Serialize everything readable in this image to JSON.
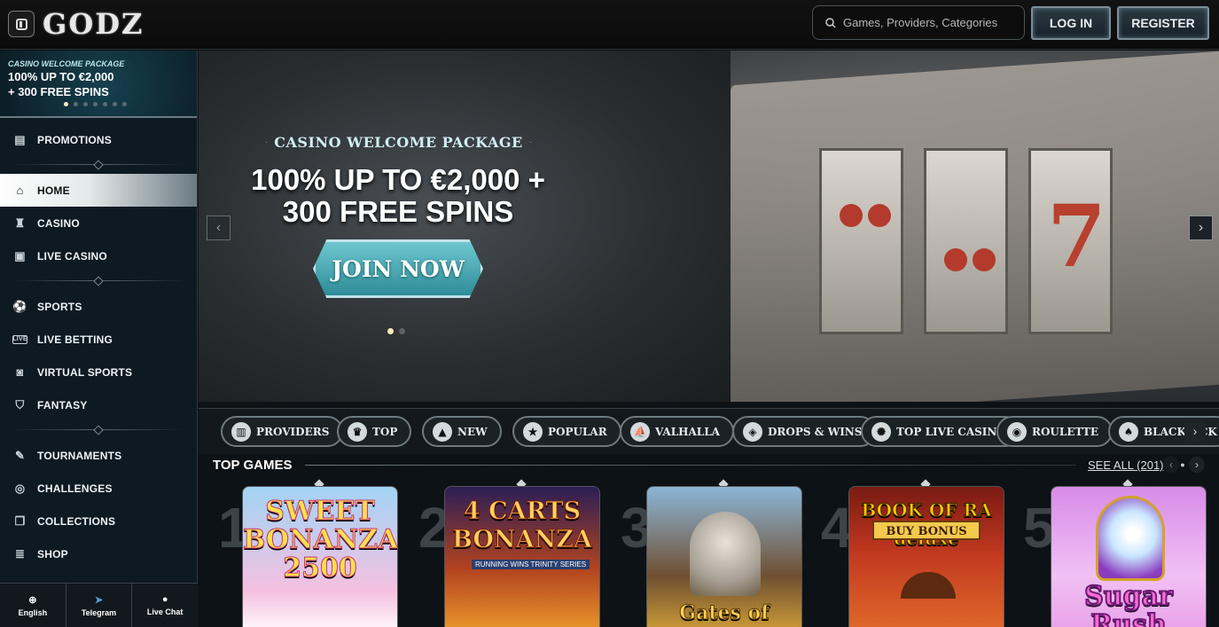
{
  "header": {
    "logo": "GODZ",
    "search_placeholder": "Games, Providers, Categories",
    "login_label": "LOG IN",
    "register_label": "REGISTER"
  },
  "sidebar": {
    "promo": {
      "small": "CASINO WELCOME PACKAGE",
      "big_line1": "100% UP TO €2,000",
      "big_line2": "+ 300 FREE SPINS",
      "dots_total": 7,
      "dot_active": 1
    },
    "items": [
      {
        "label": "PROMOTIONS",
        "icon": "gift-box-icon"
      },
      {
        "label": "HOME",
        "icon": "temple-icon",
        "active": true
      },
      {
        "label": "CASINO",
        "icon": "casino-icon"
      },
      {
        "label": "LIVE CASINO",
        "icon": "cards-icon"
      },
      {
        "label": "SPORTS",
        "icon": "soccer-ball-icon"
      },
      {
        "label": "LIVE BETTING",
        "icon": "live-icon"
      },
      {
        "label": "VIRTUAL SPORTS",
        "icon": "vr-icon"
      },
      {
        "label": "FANTASY",
        "icon": "shield-icon"
      },
      {
        "label": "TOURNAMENTS",
        "icon": "trophy-icon"
      },
      {
        "label": "CHALLENGES",
        "icon": "target-icon"
      },
      {
        "label": "COLLECTIONS",
        "icon": "collection-icon"
      },
      {
        "label": "SHOP",
        "icon": "coins-icon"
      }
    ],
    "bottom": [
      {
        "label": "English",
        "icon": "uk-flag-icon"
      },
      {
        "label": "Telegram",
        "icon": "telegram-icon"
      },
      {
        "label": "Live Chat",
        "icon": "chat-bubble-icon"
      }
    ]
  },
  "hero": {
    "subtitle": "CASINO WELCOME PACKAGE",
    "title_line1": "100% UP TO €2,000 +",
    "title_line2": "300 FREE SPINS",
    "cta": "JOIN NOW",
    "dots_total": 2,
    "dot_active": 1
  },
  "categories": [
    {
      "label": "PROVIDERS",
      "icon": "book-icon"
    },
    {
      "label": "TOP",
      "icon": "viking-helmet-icon"
    },
    {
      "label": "NEW",
      "icon": "bell-icon"
    },
    {
      "label": "POPULAR",
      "icon": "star-icon"
    },
    {
      "label": "VALHALLA",
      "icon": "ship-icon"
    },
    {
      "label": "DROPS & WINS",
      "icon": "drops-wins-icon"
    },
    {
      "label": "TOP LIVE CASINO",
      "icon": "chip-icon"
    },
    {
      "label": "ROULETTE",
      "icon": "roulette-icon"
    },
    {
      "label": "BLACKJACK",
      "icon": "blackjack-icon"
    }
  ],
  "top_games": {
    "title": "TOP GAMES",
    "see_all": "SEE ALL (201)",
    "games": [
      {
        "rank": "1",
        "name": "SWEET BONANZA 2500"
      },
      {
        "rank": "2",
        "name": "4 CARTS BONANZA",
        "tag": "RUNNING WINS TRINITY SERIES"
      },
      {
        "rank": "3",
        "name": "Gates of"
      },
      {
        "rank": "4",
        "name": "BOOK OF RA deluxe",
        "tag": "BUY BONUS"
      },
      {
        "rank": "5",
        "name": "Sugar Rush"
      }
    ]
  }
}
